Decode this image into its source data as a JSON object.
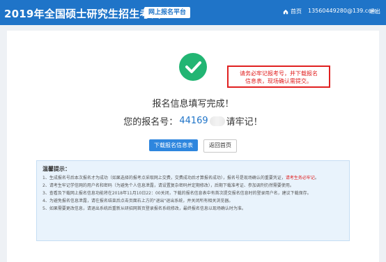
{
  "header": {
    "title": "2019年全国硕士研究生招生考试",
    "platform": "网上报名平台",
    "home": "首页",
    "user": "13560449280@139.com",
    "logout": "退出"
  },
  "main": {
    "reminder_line1": "请务必牢记报考号，并下载报名",
    "reminder_line2": "信息表，现场确认需提交。",
    "done_title": "报名信息填写完成！",
    "reg_prefix": "您的报名号：",
    "reg_number_visible": "44169",
    "reg_suffix": "请牢记！",
    "download_button": "下载报名信息表",
    "back_button": "返回首页"
  },
  "tips": {
    "title": "温馨提示：",
    "item1_text": "1、生成报名号后本次报名才为成功（如果选择的报考点采取网上交费，交费成功后才算报名成功），报名号是现场确认的重要凭证，",
    "item1_red": "请考生务必牢记",
    "item1_end": "。",
    "item2": "2、请考生牢记学信网的用户名和密码（为避免个人信息泄露，请设置复杂密码并定期修改），后期下载准考证、参加调剂仍然需要使用。",
    "item3": "3、查看及下载网上报名信息功能将在2018年11月10日22：00关闭，下载的报名信息表中有首次提交报名信息时的登录用户名，建议下载保存。",
    "item4": "4、为避免报名信息泄露，请在报名结束后点击页面右上方的\"退出\"退出系统，并关闭所有相关浏览器。",
    "item5": "5、如果需要更改信息，请退出系统后重新从研招网首页登录报名系统修改，最终报名信息以现场确认时为准。"
  },
  "colors": {
    "header_bg": "#1f74c8",
    "accent": "#2e86de",
    "success": "#22b573",
    "alert": "#e02020"
  }
}
